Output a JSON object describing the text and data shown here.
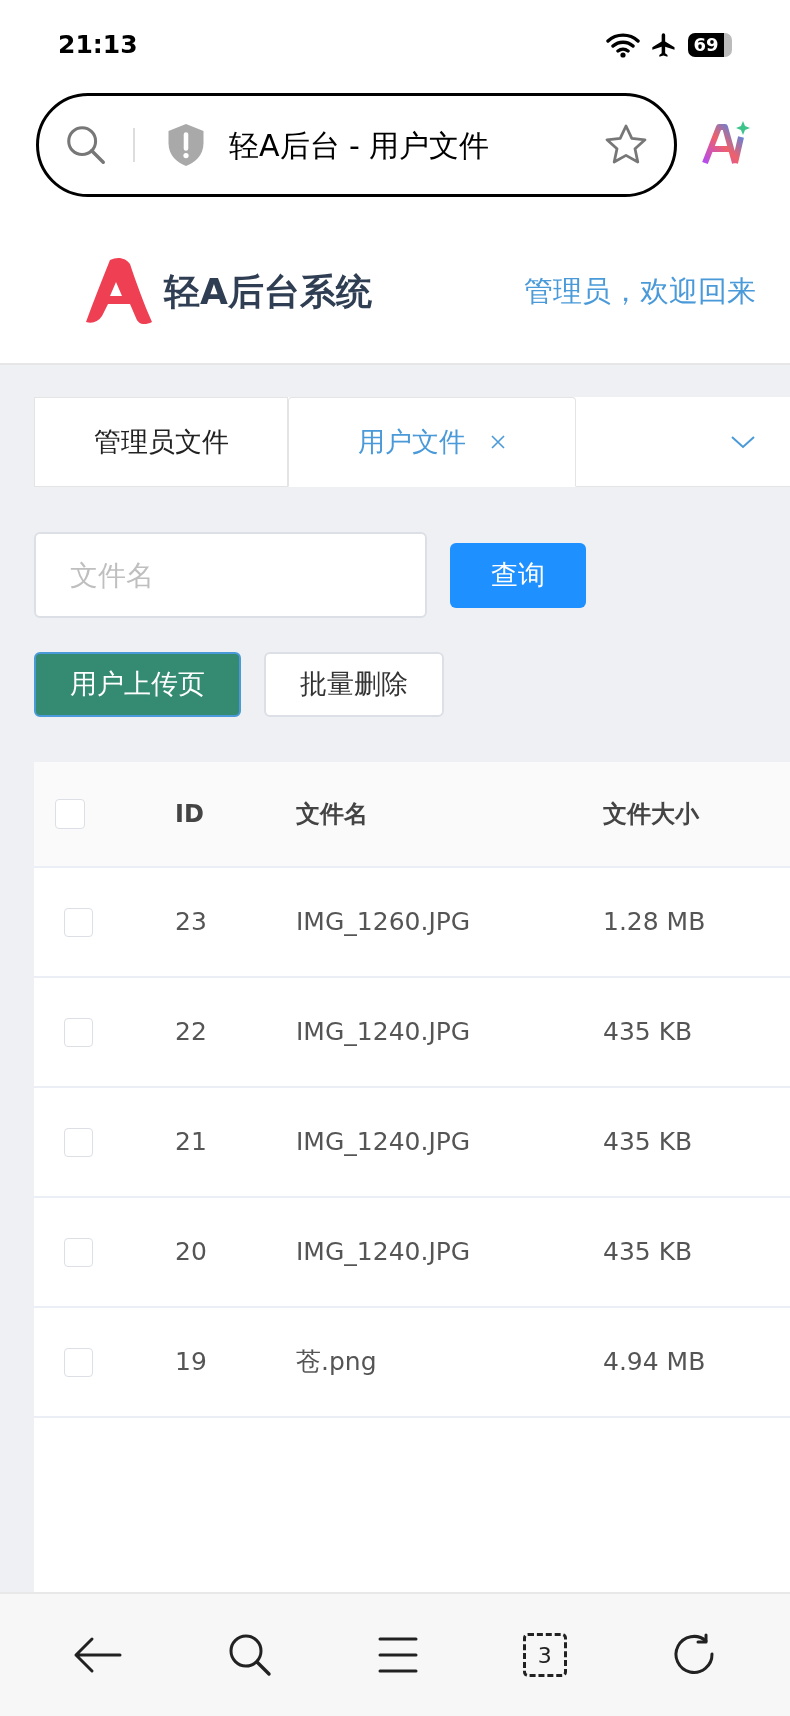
{
  "status_bar": {
    "time": "21:13",
    "battery": "69"
  },
  "browser": {
    "address": "轻A后台 - 用户文件",
    "tab_count": "3"
  },
  "header": {
    "title": "轻A后台系统",
    "welcome": "管理员，欢迎回来"
  },
  "tabs": [
    {
      "label": "管理员文件",
      "selected": false,
      "closable": false
    },
    {
      "label": "用户文件",
      "selected": true,
      "closable": true
    }
  ],
  "search": {
    "placeholder": "文件名",
    "button": "查询"
  },
  "actions": [
    {
      "label": "用户上传页",
      "kind": "primary"
    },
    {
      "label": "批量删除",
      "kind": "default"
    }
  ],
  "table": {
    "columns": [
      "ID",
      "文件名",
      "文件大小"
    ],
    "all_checked": false,
    "rows": [
      {
        "id": "23",
        "name": "IMG_1260.JPG",
        "size": "1.28 MB",
        "checked": false
      },
      {
        "id": "22",
        "name": "IMG_1240.JPG",
        "size": "435 KB",
        "checked": false
      },
      {
        "id": "21",
        "name": "IMG_1240.JPG",
        "size": "435 KB",
        "checked": false
      },
      {
        "id": "20",
        "name": "IMG_1240.JPG",
        "size": "435 KB",
        "checked": false
      },
      {
        "id": "19",
        "name": "苍.png",
        "size": "4.94 MB",
        "checked": false
      }
    ]
  }
}
